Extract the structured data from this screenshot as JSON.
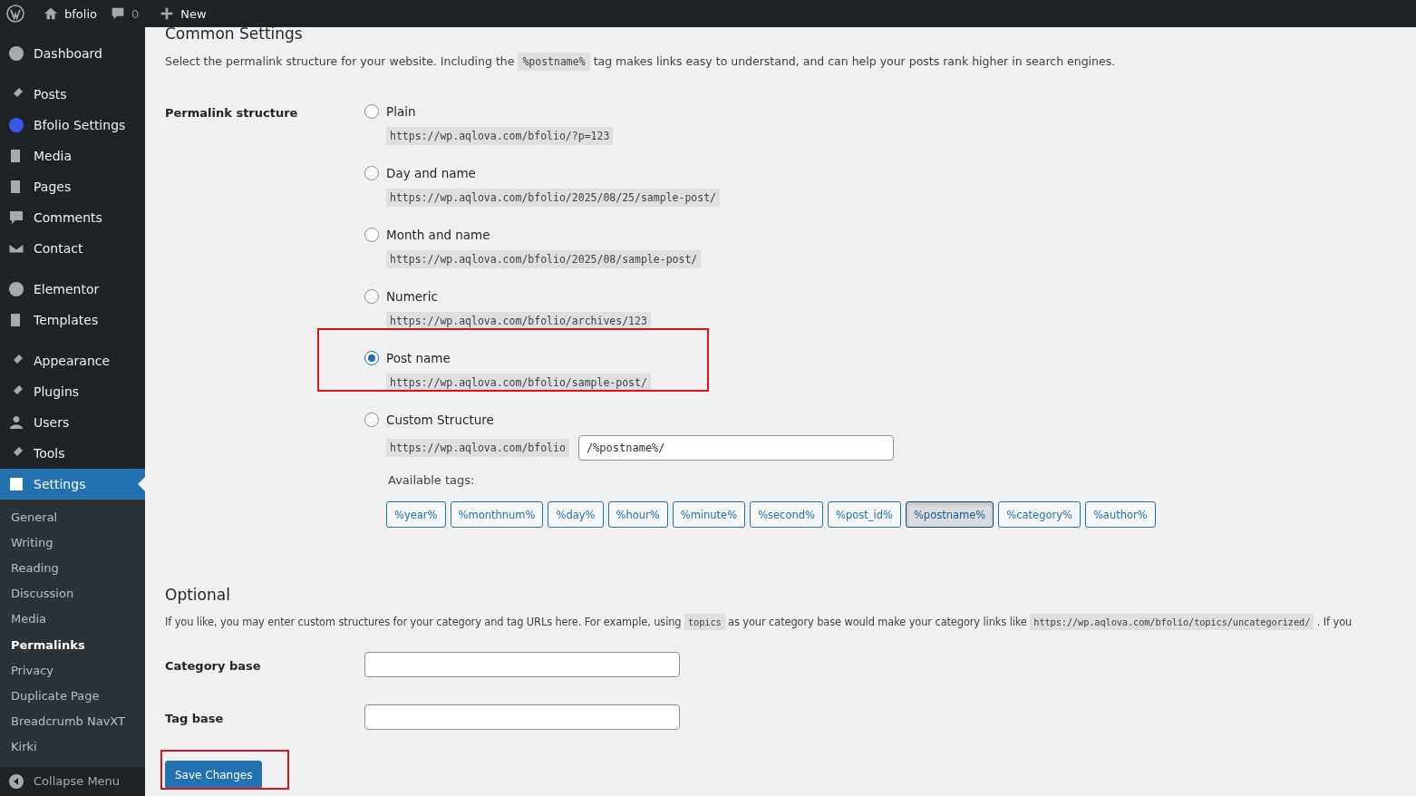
{
  "admin_bar": {
    "site": "bfolio",
    "comments": "0",
    "new": "New"
  },
  "sidebar": {
    "groups": [
      [
        {
          "label": "Dashboard",
          "selected": false
        }
      ],
      [
        {
          "label": "Posts",
          "selected": false
        },
        {
          "label": "Bfolio Settings",
          "selected": false
        },
        {
          "label": "Media",
          "selected": false
        },
        {
          "label": "Pages",
          "selected": false
        },
        {
          "label": "Comments",
          "selected": false
        },
        {
          "label": "Contact",
          "selected": false
        }
      ],
      [
        {
          "label": "Elementor",
          "selected": false
        },
        {
          "label": "Templates",
          "selected": false
        }
      ],
      [
        {
          "label": "Appearance",
          "selected": false
        },
        {
          "label": "Plugins",
          "selected": false
        },
        {
          "label": "Users",
          "selected": false
        },
        {
          "label": "Tools",
          "selected": false
        },
        {
          "label": "Settings",
          "selected": true
        }
      ]
    ],
    "submenu": [
      {
        "label": "General",
        "selected": false
      },
      {
        "label": "Writing",
        "selected": false
      },
      {
        "label": "Reading",
        "selected": false
      },
      {
        "label": "Discussion",
        "selected": false
      },
      {
        "label": "Media",
        "selected": false
      },
      {
        "label": "Permalinks",
        "selected": true
      },
      {
        "label": "Privacy",
        "selected": false
      },
      {
        "label": "Duplicate Page",
        "selected": false
      },
      {
        "label": "Breadcrumb NavXT",
        "selected": false
      },
      {
        "label": "Kirki",
        "selected": false
      }
    ],
    "collapse": "Collapse Menu"
  },
  "common": {
    "title": "Common Settings",
    "description": [
      {
        "kind": "text",
        "text": "Select the permalink structure for your website. Including the "
      },
      {
        "kind": "code",
        "text": "%postname%"
      },
      {
        "kind": "text",
        "text": " tag makes links easy to understand, and can help your posts rank higher in search engines."
      }
    ],
    "label": "Permalink structure",
    "options": [
      {
        "kind": "preset",
        "label": "Plain",
        "url": "https://wp.aqlova.com/bfolio/?p=123",
        "selected": false,
        "highlighted": false
      },
      {
        "kind": "preset",
        "label": "Day and name",
        "url": "https://wp.aqlova.com/bfolio/2025/08/25/sample-post/",
        "selected": false,
        "highlighted": false
      },
      {
        "kind": "preset",
        "label": "Month and name",
        "url": "https://wp.aqlova.com/bfolio/2025/08/sample-post/",
        "selected": false,
        "highlighted": false
      },
      {
        "kind": "preset",
        "label": "Numeric",
        "url": "https://wp.aqlova.com/bfolio/archives/123",
        "selected": false,
        "highlighted": false
      },
      {
        "kind": "preset",
        "label": "Post name",
        "url": "https://wp.aqlova.com/bfolio/sample-post/",
        "selected": true,
        "highlighted": true
      },
      {
        "kind": "custom",
        "label": "Custom Structure",
        "url": "https://wp.aqlova.com/bfolio",
        "value": "/%postname%/",
        "selected": false,
        "highlighted": false
      }
    ],
    "tags_label": "Available tags:",
    "tags": [
      {
        "label": "%year%",
        "selected": false
      },
      {
        "label": "%monthnum%",
        "selected": false
      },
      {
        "label": "%day%",
        "selected": false
      },
      {
        "label": "%hour%",
        "selected": false
      },
      {
        "label": "%minute%",
        "selected": false
      },
      {
        "label": "%second%",
        "selected": false
      },
      {
        "label": "%post_id%",
        "selected": false
      },
      {
        "label": "%postname%",
        "selected": true
      },
      {
        "label": "%category%",
        "selected": false
      },
      {
        "label": "%author%",
        "selected": false
      }
    ]
  },
  "optional": {
    "title": "Optional",
    "description": [
      {
        "kind": "text",
        "text": "If you like, you may enter custom structures for your category and tag URLs here. For example, using "
      },
      {
        "kind": "code",
        "text": "topics"
      },
      {
        "kind": "text",
        "text": " as your category base would make your category links like "
      },
      {
        "kind": "code",
        "text": "https://wp.aqlova.com/bfolio/topics/uncategorized/"
      },
      {
        "kind": "text",
        "text": " . If you"
      }
    ],
    "fields": [
      {
        "label": "Category base"
      },
      {
        "label": "Tag base"
      }
    ]
  },
  "save_button": {
    "label": "Save Changes",
    "highlighted": true
  }
}
